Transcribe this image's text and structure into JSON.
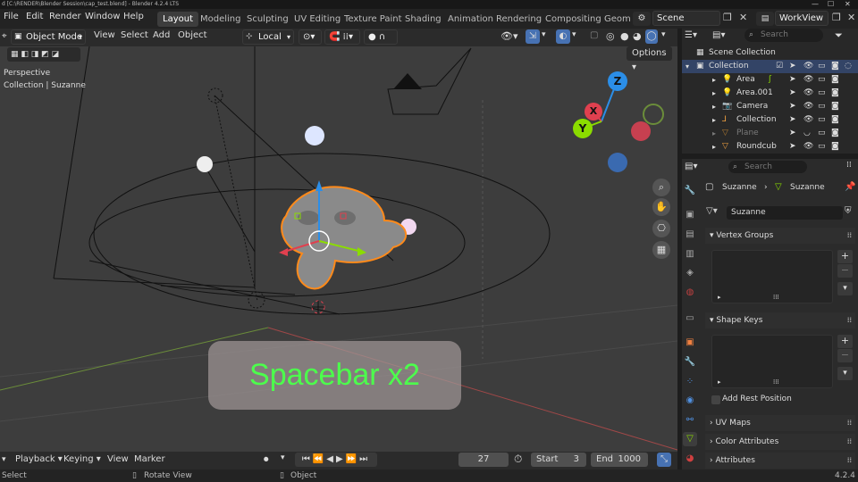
{
  "titlebar": {
    "text": "d [C:\\RENDER\\Blender Session\\cap_test.blend] - Blender 4.2.4 LTS"
  },
  "menubar": {
    "items": [
      "File",
      "Edit",
      "Render",
      "Window",
      "Help"
    ],
    "workspaces": [
      "Layout",
      "Modeling",
      "Sculpting",
      "UV Editing",
      "Texture Paint",
      "Shading",
      "Animation",
      "Rendering",
      "Compositing",
      "Geom"
    ],
    "scene_label": "Scene",
    "viewlayer_label": "WorkView"
  },
  "viewport_header": {
    "mode": "Object Mode",
    "menus": [
      "View",
      "Select",
      "Add",
      "Object"
    ],
    "transform_orientation": "Local",
    "options_label": "Options"
  },
  "viewport": {
    "view_name": "Perspective",
    "context": "Collection | Suzanne",
    "overlay_text": "Spacebar x2",
    "axis_labels": {
      "z": "Z",
      "x": "X",
      "y": "Y"
    }
  },
  "timeline": {
    "menus": [
      "Playback",
      "Keying",
      "View",
      "Marker"
    ],
    "current_frame": "27",
    "start_label": "Start",
    "start_value": "3",
    "end_label": "End",
    "end_value": "1000"
  },
  "statusbar": {
    "left": "Select",
    "middle": "Rotate View",
    "right_action": "Object",
    "version": "4.2.4"
  },
  "outliner": {
    "search_placeholder": "Search",
    "root": "Scene Collection",
    "collection": "Collection",
    "items": [
      {
        "name": "Area",
        "icon": "light-icon",
        "dim": false
      },
      {
        "name": "Area.001",
        "icon": "light-icon",
        "dim": false
      },
      {
        "name": "Camera",
        "icon": "camera-icon",
        "dim": false
      },
      {
        "name": "Collection",
        "icon": "collection-icon",
        "dim": false
      },
      {
        "name": "Plane",
        "icon": "mesh-icon",
        "dim": true
      },
      {
        "name": "Roundcub",
        "icon": "mesh-icon",
        "dim": false
      }
    ]
  },
  "properties": {
    "search_placeholder": "Search",
    "object_name": "Suzanne",
    "mesh_name": "Suzanne",
    "data_name": "Suzanne",
    "panels": {
      "vertex_groups": "Vertex Groups",
      "shape_keys": "Shape Keys",
      "add_rest_position": "Add Rest Position",
      "uv_maps": "UV Maps",
      "color_attributes": "Color Attributes",
      "attributes": "Attributes"
    }
  },
  "colors": {
    "accent": "#4772b3",
    "selection_outline": "#ff8a1a",
    "overlay_text": "#4cff4c",
    "axis_x": "#e0404f",
    "axis_y": "#8bdc00",
    "axis_z": "#2b8ee8"
  }
}
